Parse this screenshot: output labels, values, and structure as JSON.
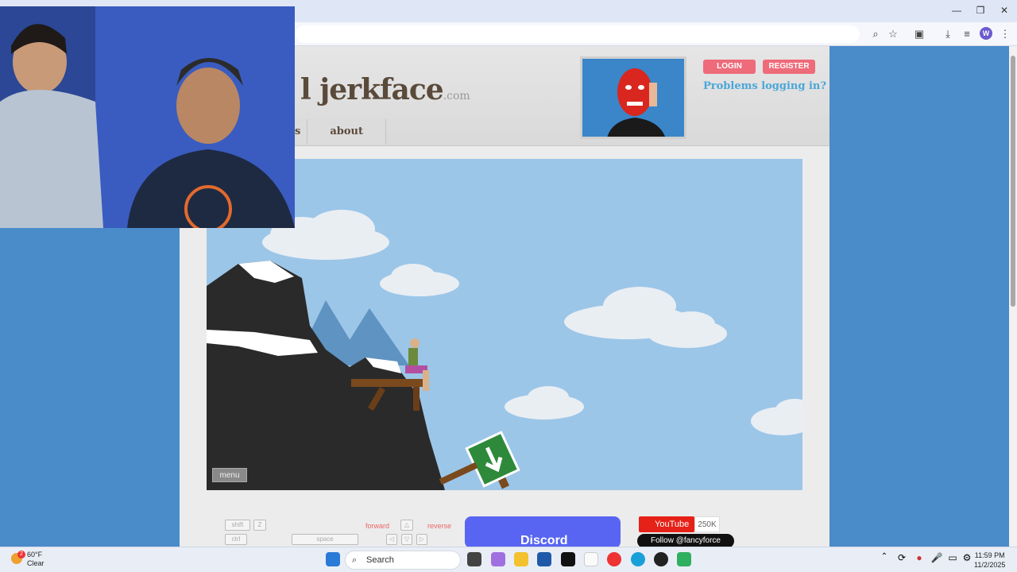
{
  "site": {
    "logo_main": "l jerkface",
    "logo_suffix": ".com",
    "nav": [
      "s",
      "about"
    ],
    "login_label": "LOGIN",
    "register_label": "REGISTER",
    "problems_label": "Problems logging in?"
  },
  "game": {
    "menu_label": "menu"
  },
  "controls": {
    "keys": [
      "shift",
      "Z",
      "ctrl",
      "space"
    ],
    "forward_label": "forward",
    "reverse_label": "reverse",
    "discord_label": "Discord",
    "youtube_label": "YouTube",
    "youtube_count": "250K",
    "twitter_label": "Follow @fancyforce"
  },
  "taskbar": {
    "weather_temp": "60°F",
    "weather_desc": "Clear",
    "search_placeholder": "Search",
    "time": "11:59 PM",
    "date": "11/2/2025",
    "notification_count": "2"
  },
  "browser": {
    "profile_letter": "W"
  },
  "colors": {
    "page_bg": "#4a8bc9",
    "accent_pink": "#ee6b7a",
    "sky": "#9cc6e8"
  }
}
